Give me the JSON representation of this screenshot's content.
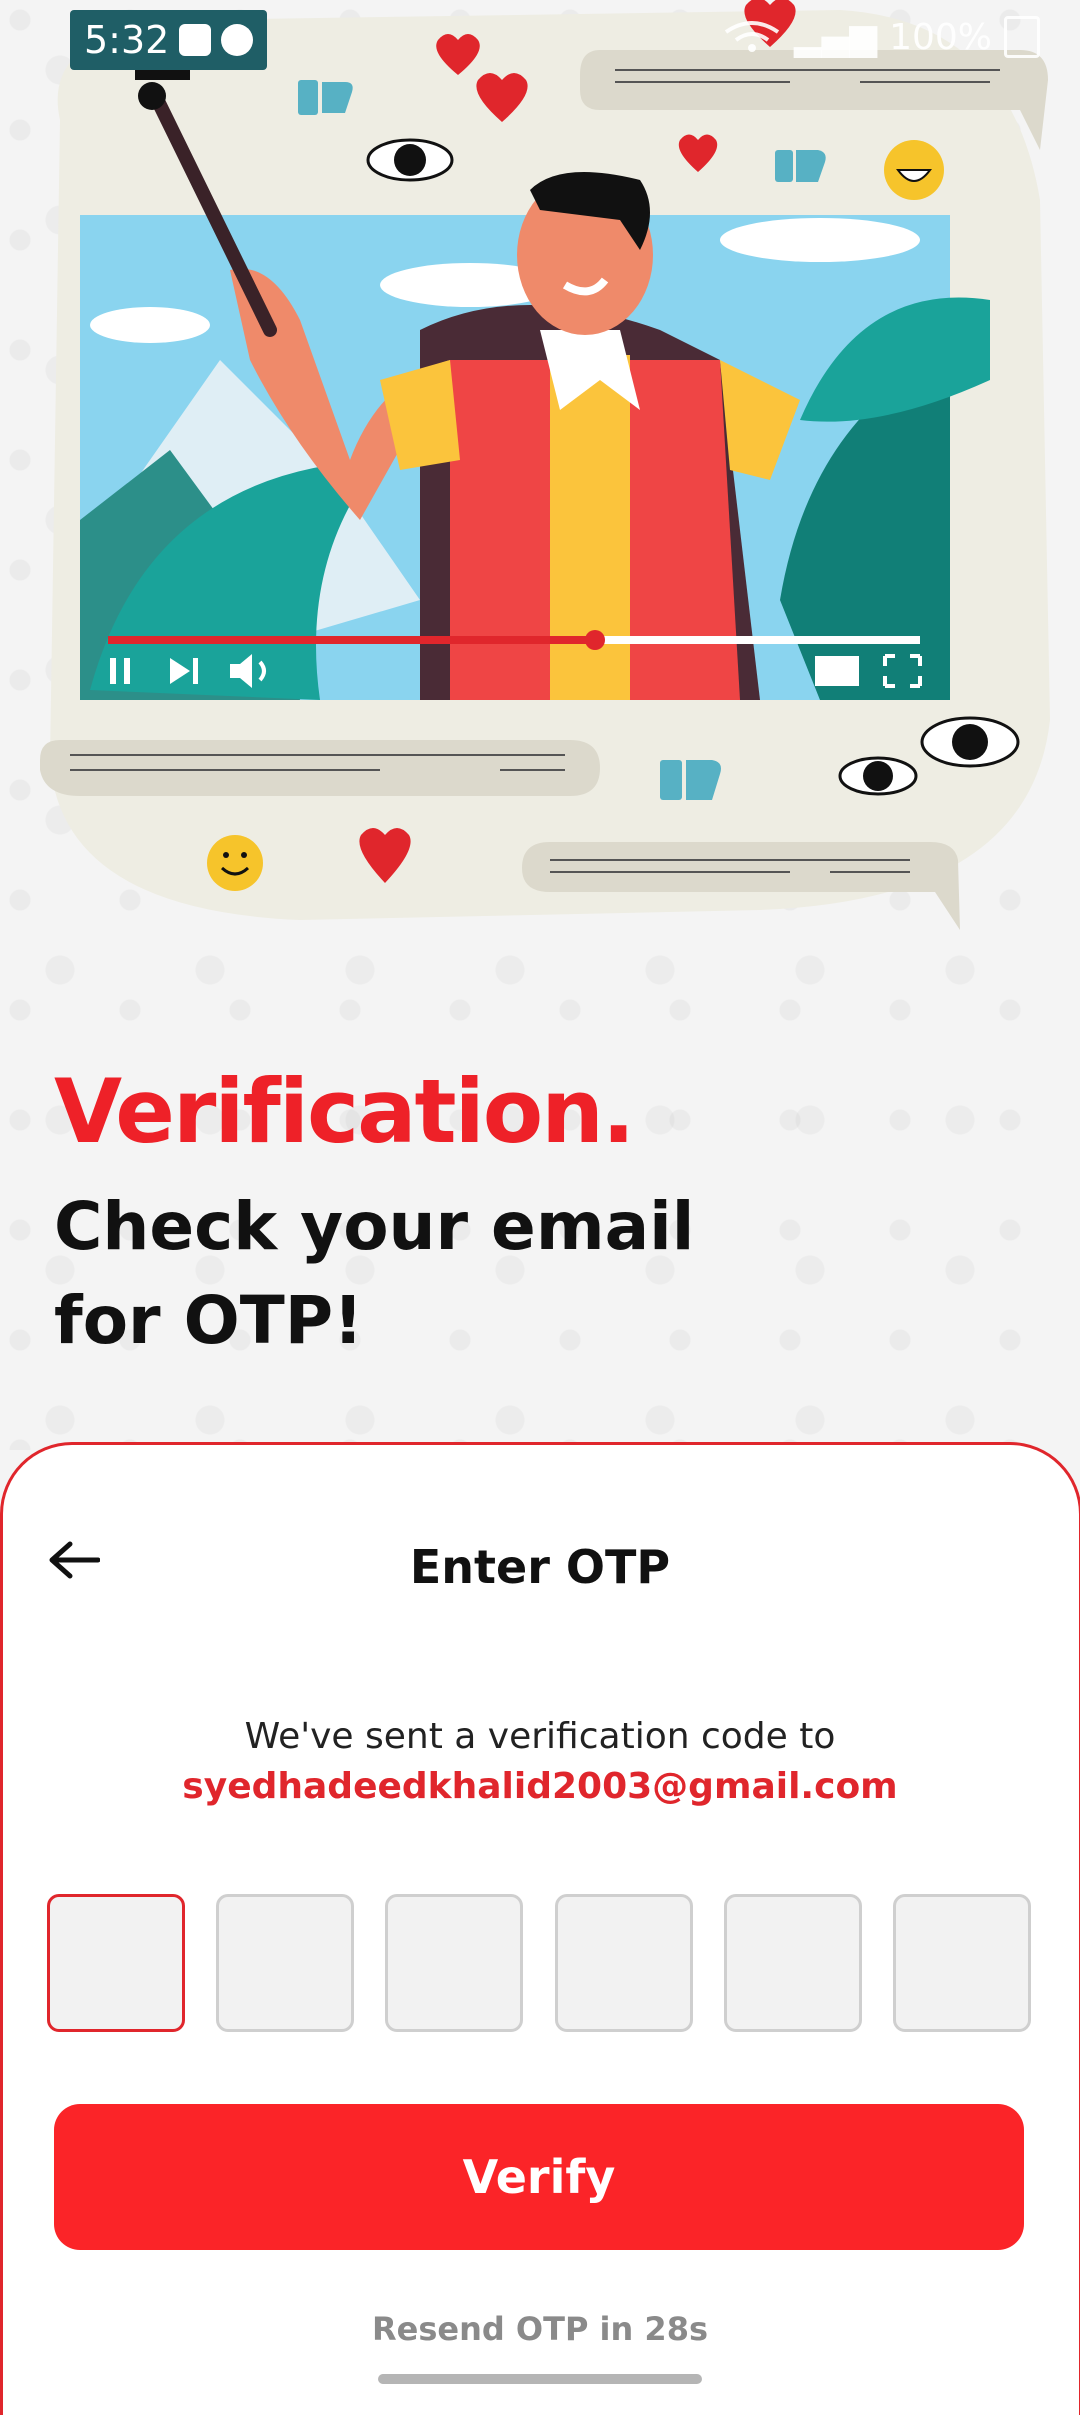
{
  "status_bar": {
    "time": "5:32",
    "battery_text": "100%",
    "icons": [
      "gallery-icon",
      "whatsapp-icon",
      "wifi-icon",
      "signal-icon",
      "battery-icon"
    ]
  },
  "hero": {
    "illustration": "man-taking-selfie-video-illustration"
  },
  "heading": {
    "title": "Verification.",
    "subtitle": "Check your email for OTP!"
  },
  "otp_card": {
    "title": "Enter OTP",
    "sent_text": "We've sent a verification code to",
    "email": "syedhadeedkhalid2003@gmail.com",
    "otp_digits": [
      "",
      "",
      "",
      "",
      "",
      ""
    ],
    "verify_label": "Verify",
    "resend_text": "Resend OTP in 28s"
  },
  "colors": {
    "accent": "#e0262c",
    "button": "#fb2428",
    "text": "#111111"
  }
}
